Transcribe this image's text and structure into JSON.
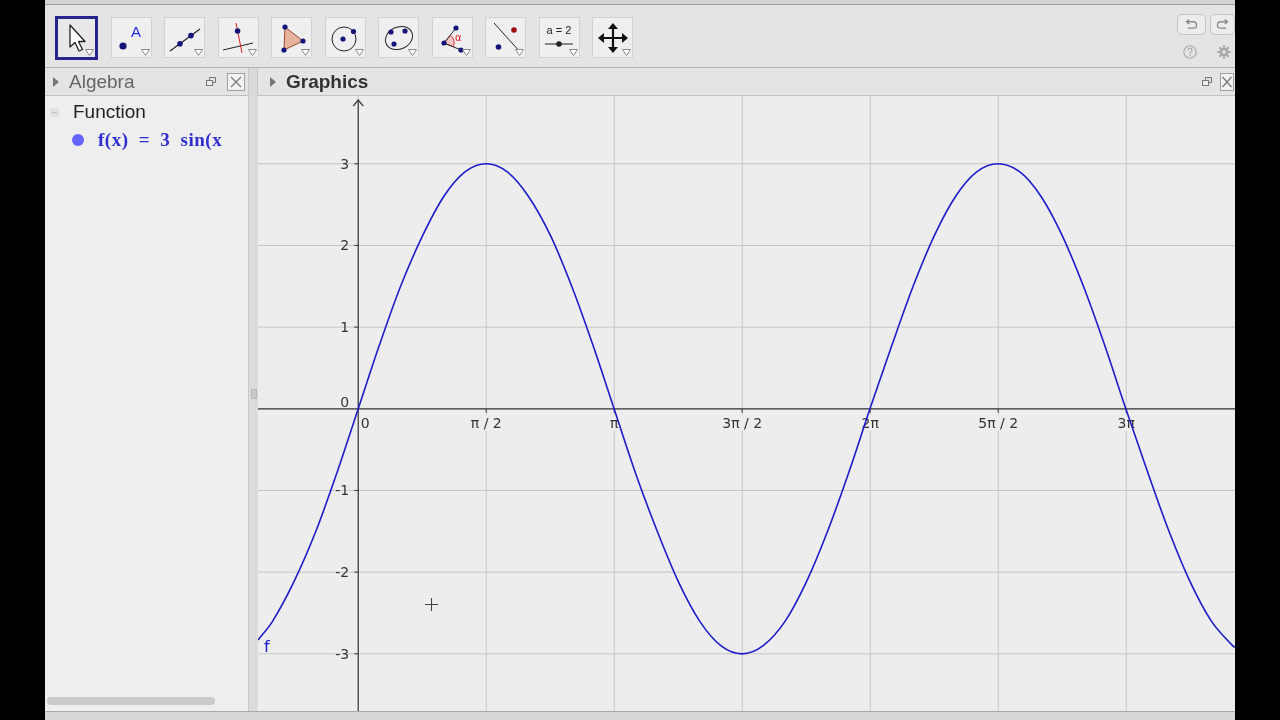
{
  "toolbar": {
    "tools": [
      {
        "kind": "move",
        "selected": true
      },
      {
        "kind": "point",
        "selected": false,
        "label": "A"
      },
      {
        "kind": "line",
        "selected": false
      },
      {
        "kind": "perpendicular",
        "selected": false
      },
      {
        "kind": "polygon",
        "selected": false
      },
      {
        "kind": "circle",
        "selected": false
      },
      {
        "kind": "conic",
        "selected": false
      },
      {
        "kind": "angle",
        "selected": false,
        "label": "α"
      },
      {
        "kind": "reflect",
        "selected": false
      },
      {
        "kind": "slider",
        "selected": false,
        "label": "a = 2"
      },
      {
        "kind": "move_view",
        "selected": false
      }
    ]
  },
  "algebra_panel": {
    "title": "Algebra",
    "active": false,
    "groups": [
      {
        "title": "Function",
        "expanded": true,
        "items": [
          {
            "text": "f(x) = 3 sin(x",
            "shown": true
          }
        ]
      }
    ]
  },
  "graphics_panel": {
    "title": "Graphics",
    "active": true,
    "chart_data": [
      {
        "type": "line",
        "x": [
          -1.23,
          -1.05,
          -0.79,
          -0.52,
          -0.26,
          0,
          0.26,
          0.52,
          0.79,
          1.05,
          1.31,
          1.57,
          1.83,
          2.09,
          2.36,
          2.62,
          2.88,
          3.14,
          3.4,
          3.67,
          3.93,
          4.19,
          4.45,
          4.71,
          4.97,
          5.24,
          5.5,
          5.76,
          6.02,
          6.28,
          6.55,
          6.81,
          7.07,
          7.33,
          7.59,
          7.85,
          8.12,
          8.38,
          8.64,
          8.9,
          9.16,
          9.42,
          9.69,
          9.95,
          10.21,
          10.47,
          10.73,
          10.76
        ],
        "series": [
          {
            "name": "f",
            "color": "#1c1cc8",
            "values": [
              -2.83,
              -2.6,
              -2.12,
              -1.5,
              -0.78,
              0,
              0.78,
              1.5,
              2.12,
              2.6,
              2.9,
              3,
              2.9,
              2.6,
              2.12,
              1.5,
              0.78,
              0,
              -0.78,
              -1.5,
              -2.12,
              -2.6,
              -2.9,
              -3,
              -2.9,
              -2.6,
              -2.12,
              -1.5,
              -0.78,
              0,
              0.78,
              1.5,
              2.12,
              2.6,
              2.9,
              3,
              2.9,
              2.6,
              2.12,
              1.5,
              0.78,
              0,
              -0.78,
              -1.5,
              -2.12,
              -2.6,
              -2.9,
              -2.92
            ]
          }
        ],
        "xlim": [
          -1.23,
          10.76
        ],
        "ylim": [
          -3.7,
          3.83
        ],
        "xticks": [
          {
            "value": 0,
            "label": "0"
          },
          {
            "value": 1.571,
            "label": "π / 2"
          },
          {
            "value": 3.142,
            "label": "π"
          },
          {
            "value": 4.712,
            "label": "3π / 2"
          },
          {
            "value": 6.283,
            "label": "2π"
          },
          {
            "value": 7.854,
            "label": "5π / 2"
          },
          {
            "value": 9.425,
            "label": "3π"
          }
        ],
        "yticks": [
          -3,
          -2,
          -1,
          0,
          1,
          2,
          3
        ],
        "grid": true
      }
    ]
  }
}
